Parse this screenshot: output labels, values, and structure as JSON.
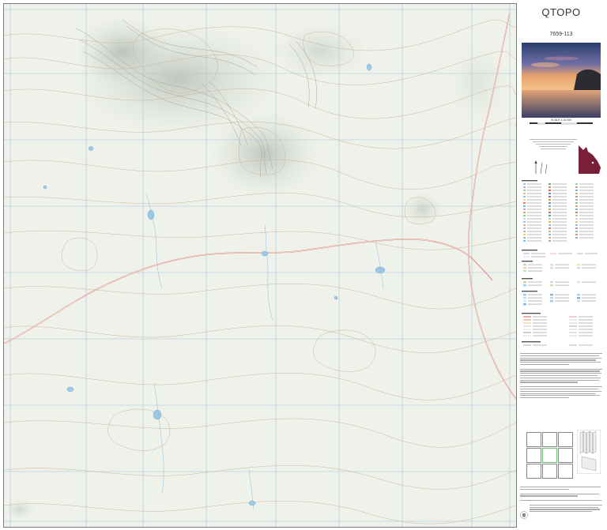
{
  "map": {
    "type": "topographic-map-sheet",
    "features": [
      "contour-lines",
      "hill-shading",
      "road",
      "waterbodies",
      "grid-lines"
    ],
    "colors": {
      "land": "#eef2ea",
      "contour": "#c9b89a",
      "road": "#d98e82",
      "water": "#9ec8e6",
      "grid": "#a9c3d8"
    }
  },
  "sidebar": {
    "title": "QTOPO",
    "sheet_number": "7659-113",
    "scale": "SCALE 1:10,000",
    "photo_description": "coastal sunset photograph",
    "index_sheets": [
      "",
      "",
      "",
      "",
      "",
      "",
      "",
      "",
      ""
    ]
  }
}
